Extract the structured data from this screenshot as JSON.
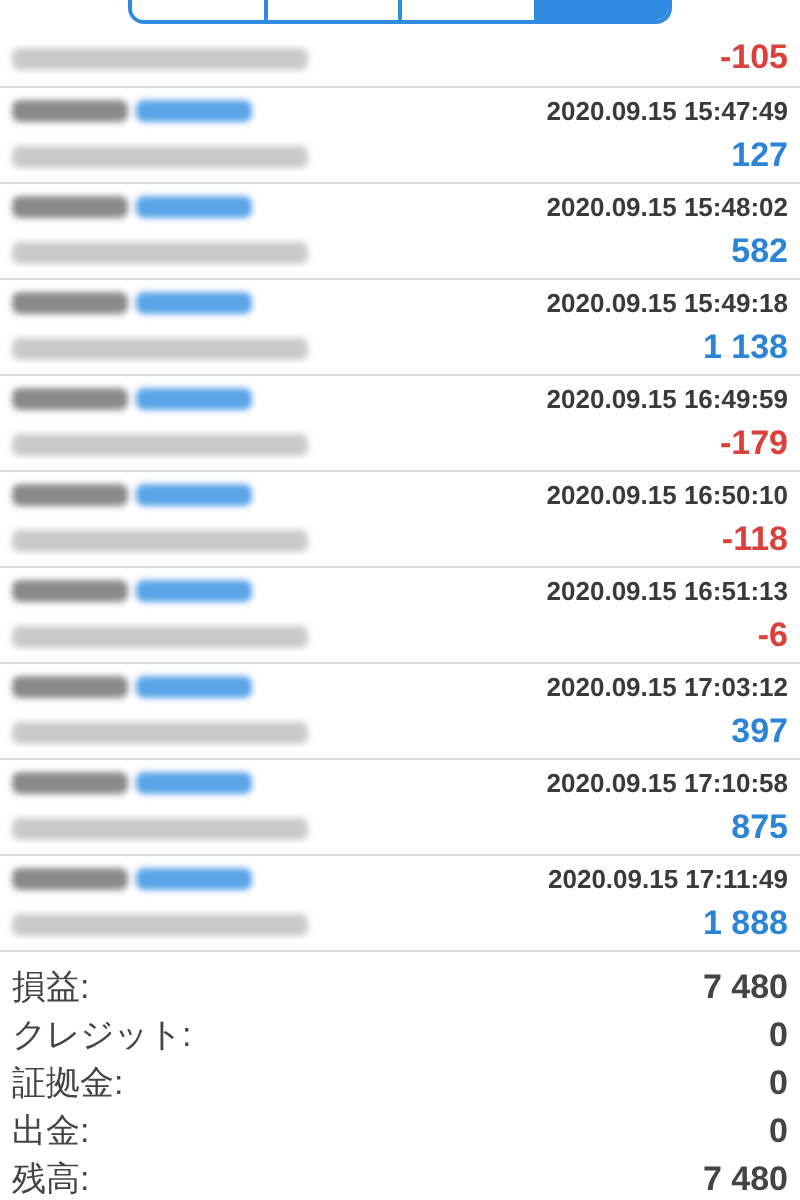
{
  "segments": [
    {
      "selected": false
    },
    {
      "selected": false
    },
    {
      "selected": false
    },
    {
      "selected": true
    }
  ],
  "first_row": {
    "profit": "-105",
    "kind": "loss"
  },
  "trades": [
    {
      "time": "2020.09.15 15:47:49",
      "profit": "127",
      "kind": "gain"
    },
    {
      "time": "2020.09.15 15:48:02",
      "profit": "582",
      "kind": "gain"
    },
    {
      "time": "2020.09.15 15:49:18",
      "profit": "1 138",
      "kind": "gain"
    },
    {
      "time": "2020.09.15 16:49:59",
      "profit": "-179",
      "kind": "loss"
    },
    {
      "time": "2020.09.15 16:50:10",
      "profit": "-118",
      "kind": "loss"
    },
    {
      "time": "2020.09.15 16:51:13",
      "profit": "-6",
      "kind": "loss"
    },
    {
      "time": "2020.09.15 17:03:12",
      "profit": "397",
      "kind": "gain"
    },
    {
      "time": "2020.09.15 17:10:58",
      "profit": "875",
      "kind": "gain"
    },
    {
      "time": "2020.09.15 17:11:49",
      "profit": "1 888",
      "kind": "gain"
    }
  ],
  "summary": [
    {
      "label": "損益:",
      "value": "7 480"
    },
    {
      "label": "クレジット:",
      "value": "0"
    },
    {
      "label": "証拠金:",
      "value": "0"
    },
    {
      "label": "出金:",
      "value": "0"
    },
    {
      "label": "残高:",
      "value": "7 480"
    }
  ]
}
